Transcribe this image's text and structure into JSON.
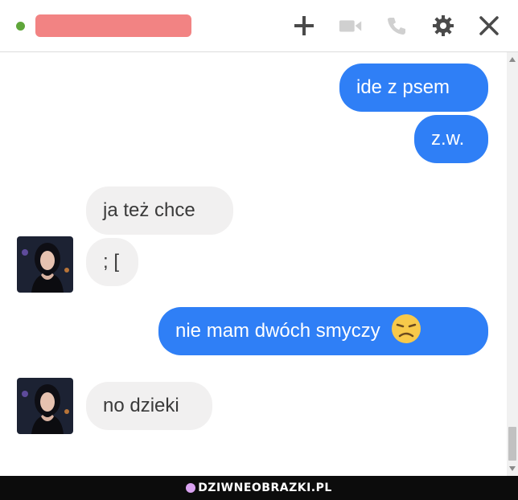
{
  "header": {
    "status_color": "#5fa63a",
    "name_redacted_color": "#f28383",
    "icons": [
      "add-icon",
      "video-call-icon",
      "phone-icon",
      "gear-icon",
      "close-icon"
    ]
  },
  "messages": [
    {
      "side": "sent",
      "text": "ide z psem"
    },
    {
      "side": "sent",
      "text": "z.w."
    },
    {
      "side": "received",
      "text": "ja też chce"
    },
    {
      "side": "received",
      "text": "; ["
    },
    {
      "side": "sent",
      "text": "nie mam dwóch smyczy",
      "emoji": "disappointed-face-emoji"
    },
    {
      "side": "received",
      "text": "no dzieki"
    }
  ],
  "colors": {
    "sent_bubble": "#2f7ff6",
    "received_bubble": "#f1f0f0"
  },
  "watermark": {
    "text": "DZIWNEOBRAZKI.PL"
  }
}
